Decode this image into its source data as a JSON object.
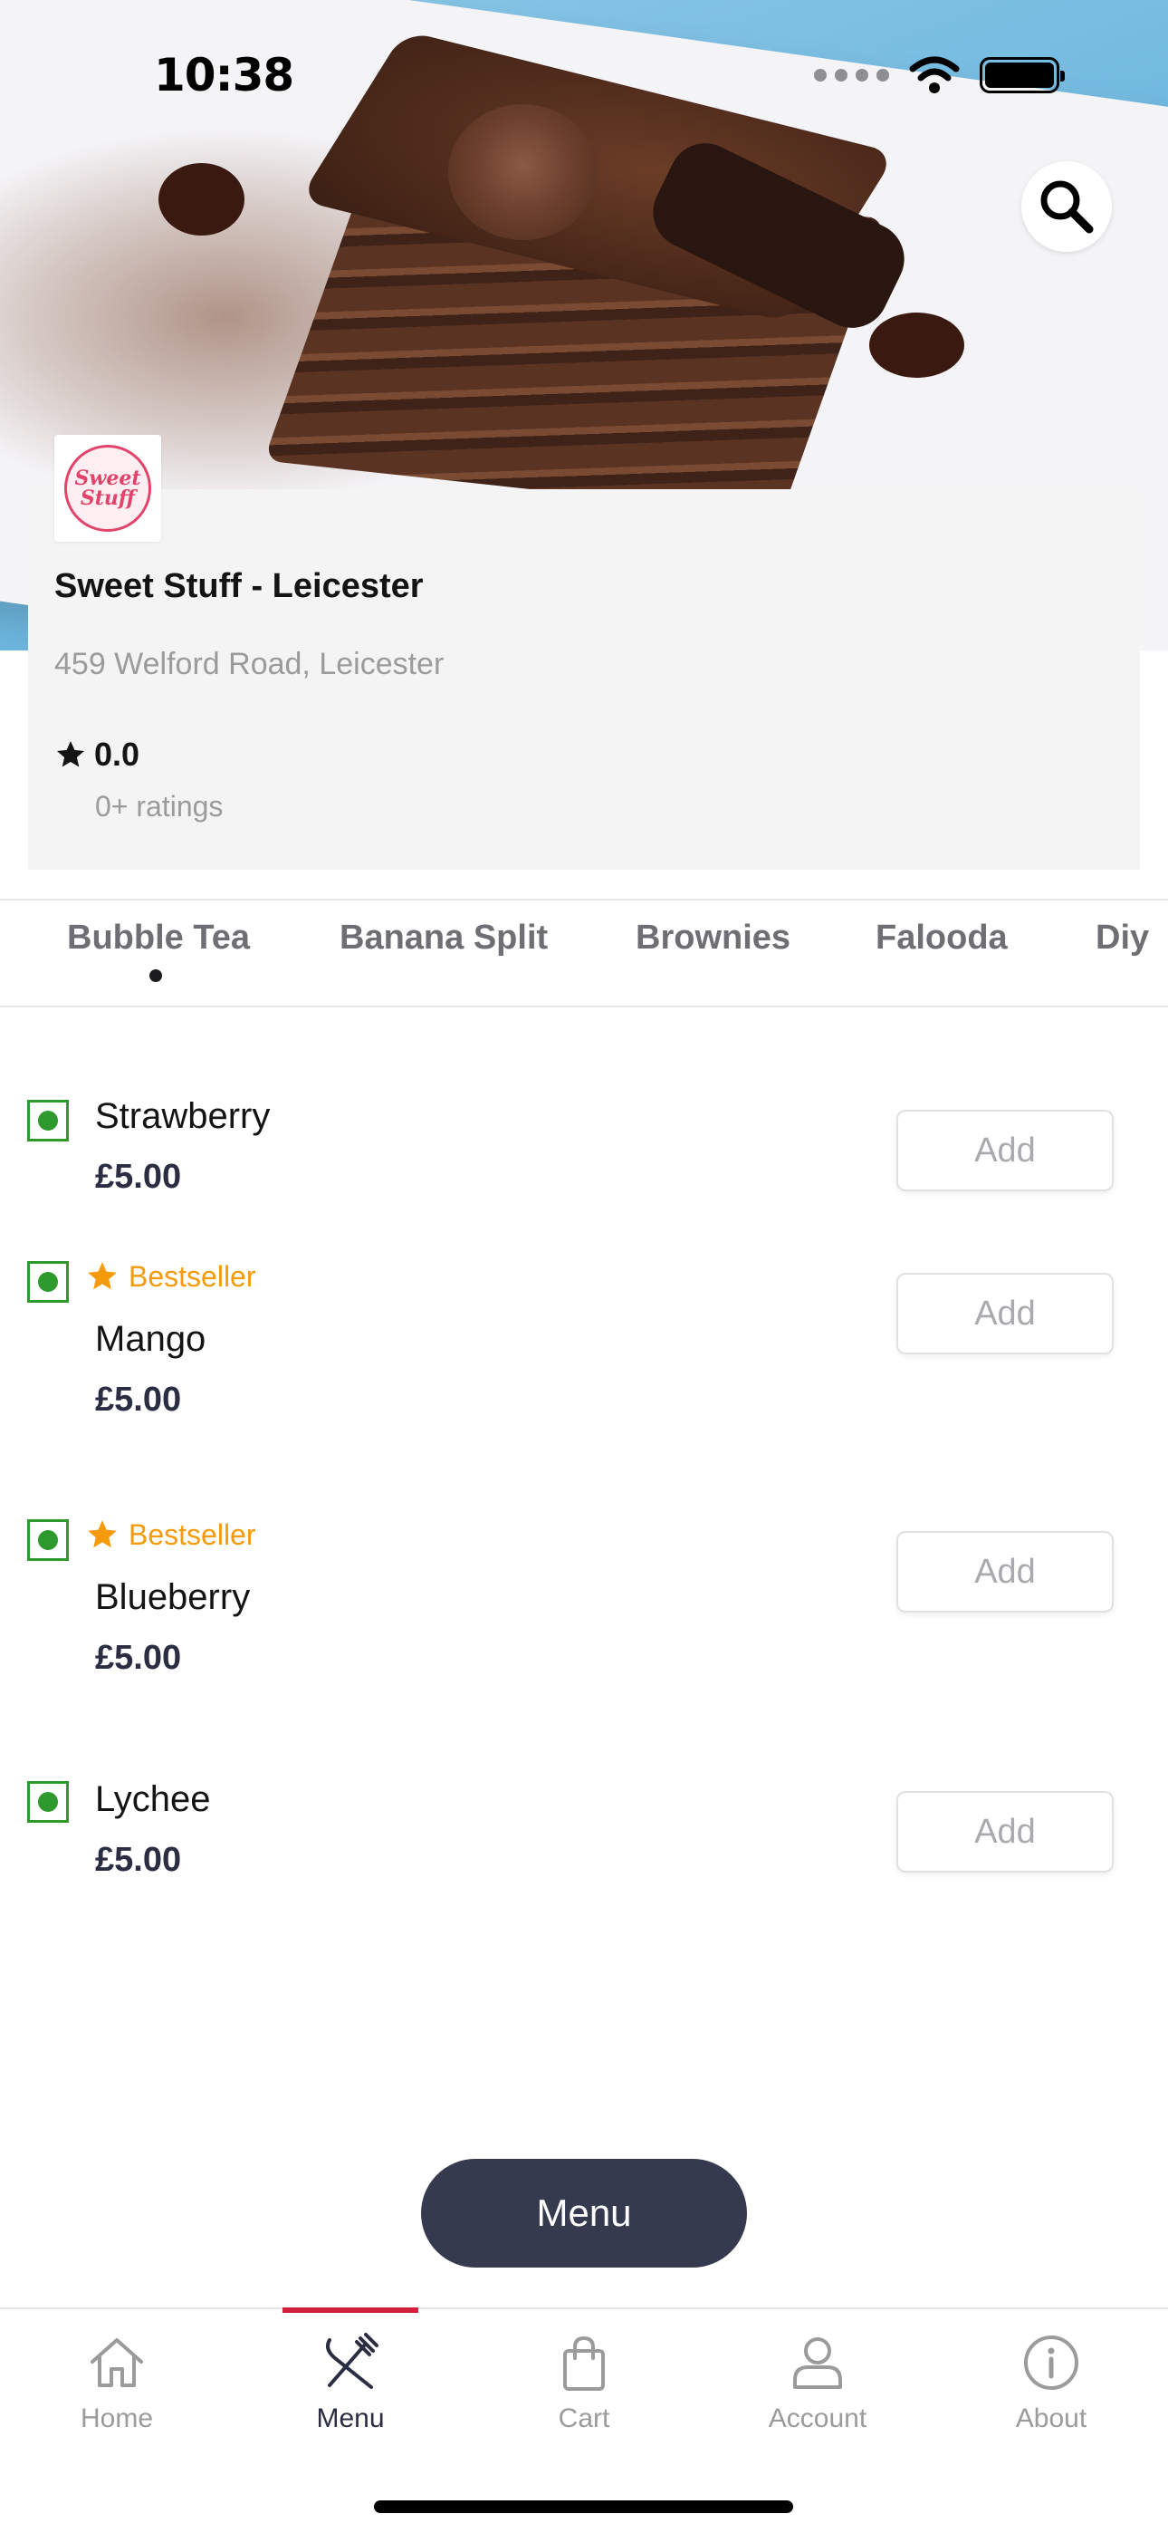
{
  "status_bar": {
    "time": "10:38"
  },
  "restaurant": {
    "logo_text": [
      "Sweet",
      "Stuff"
    ],
    "name": "Sweet Stuff - Leicester",
    "address": "459 Welford Road, Leicester",
    "rating": "0.0",
    "rating_count": "0+ ratings"
  },
  "categories": [
    {
      "label": "Bubble Tea",
      "active": true
    },
    {
      "label": "Banana Split",
      "active": false
    },
    {
      "label": "Brownies",
      "active": false
    },
    {
      "label": "Falooda",
      "active": false
    },
    {
      "label": "Diy",
      "active": false
    }
  ],
  "items": [
    {
      "name": "Strawberry",
      "price": "£5.00",
      "bestseller": false,
      "add_label": "Add"
    },
    {
      "name": "Mango",
      "price": "£5.00",
      "bestseller": true,
      "badge": "Bestseller",
      "add_label": "Add"
    },
    {
      "name": "Blueberry",
      "price": "£5.00",
      "bestseller": true,
      "badge": "Bestseller",
      "add_label": "Add"
    },
    {
      "name": "Lychee",
      "price": "£5.00",
      "bestseller": false,
      "add_label": "Add"
    }
  ],
  "menu_button": {
    "label": "Menu"
  },
  "bottom_nav": [
    {
      "label": "Home",
      "icon": "home-icon",
      "active": false
    },
    {
      "label": "Menu",
      "icon": "fork-knife-icon",
      "active": true
    },
    {
      "label": "Cart",
      "icon": "shopping-bag-icon",
      "active": false
    },
    {
      "label": "Account",
      "icon": "person-icon",
      "active": false
    },
    {
      "label": "About",
      "icon": "info-icon",
      "active": false
    }
  ],
  "colors": {
    "accent": "#d21f3c",
    "veg": "#2e9a2e",
    "bestseller": "#f59b0b",
    "menu_button": "#363a4f"
  }
}
